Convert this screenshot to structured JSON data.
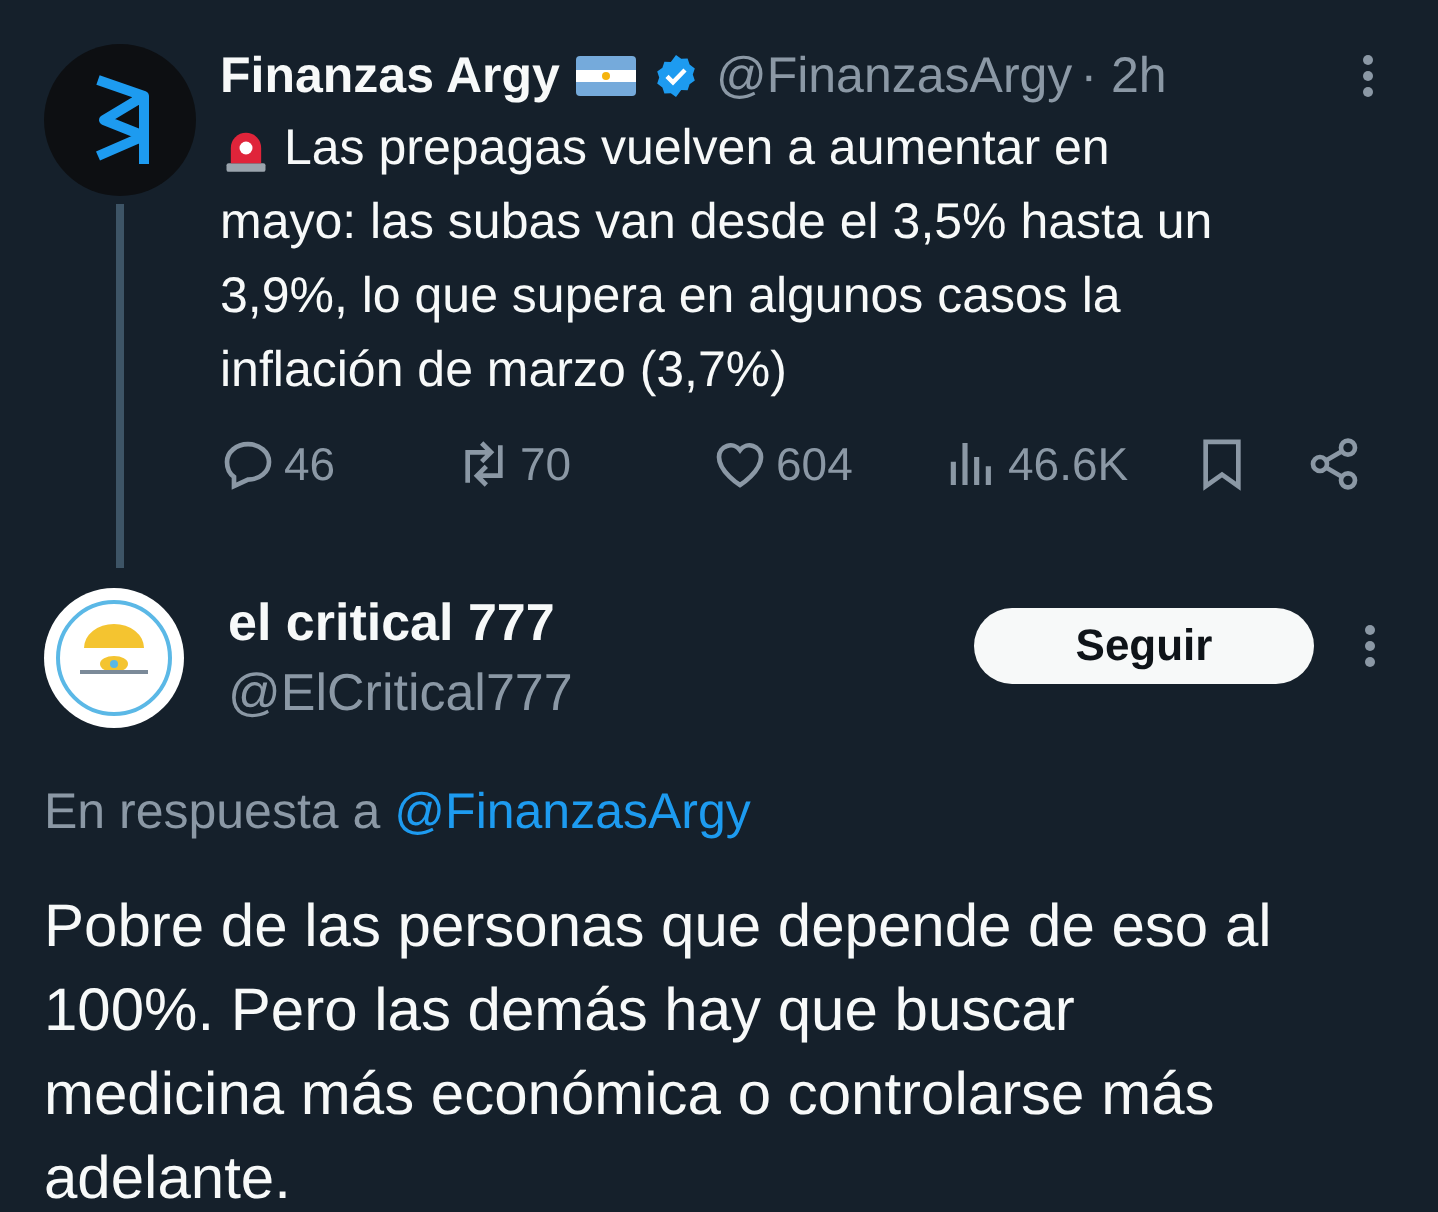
{
  "post": {
    "author": {
      "name": "Finanzas Argy",
      "handle": "@FinanzasArgy",
      "time": "· 2h",
      "verified": true,
      "flag": true
    },
    "alert_emoji": true,
    "text": "Las prepagas vuelven a aumentar en mayo: las subas van desde el 3,5% hasta un 3,9%, lo que supera en algunos casos la inflación de marzo (3,7%)",
    "actions": [
      {
        "kind": "reply",
        "count": "46"
      },
      {
        "kind": "repost",
        "count": "70"
      },
      {
        "kind": "like",
        "count": "604"
      },
      {
        "kind": "views",
        "count": "46.6K"
      },
      {
        "kind": "bookmark"
      },
      {
        "kind": "share"
      }
    ]
  },
  "reply": {
    "author": {
      "name": "el critical 777",
      "handle": "@ElCritical777"
    },
    "follow_button": "Seguir",
    "in_reply_to": {
      "prefix": "En respuesta a",
      "handle": "@FinanzasArgy"
    },
    "text": "Pobre de las personas que depende de eso al 100%. Pero las demás hay que buscar medicina más económica o controlarse más adelante."
  }
}
